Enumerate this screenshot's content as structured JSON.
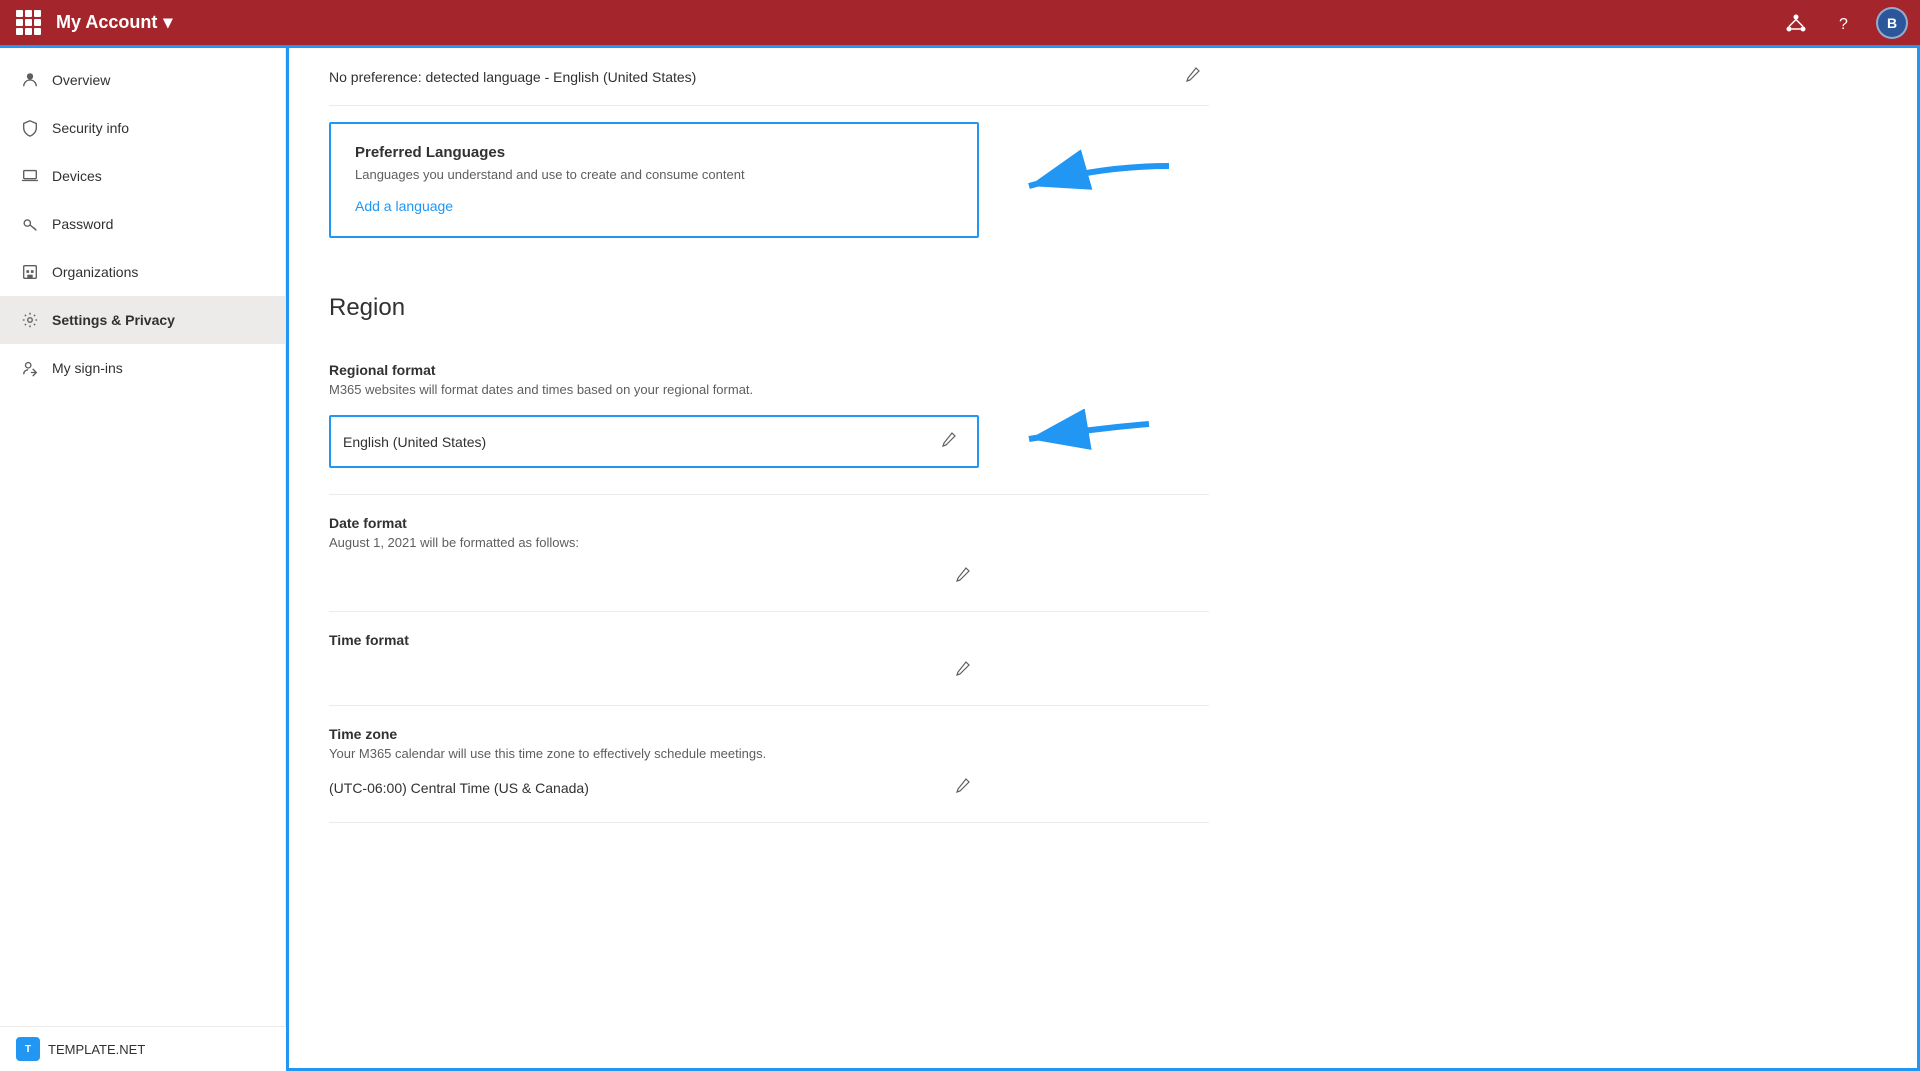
{
  "topbar": {
    "title": "My Account",
    "chevron": "▾",
    "avatar_label": "B",
    "org_icon": "⚙",
    "help_icon": "?"
  },
  "sidebar": {
    "items": [
      {
        "id": "overview",
        "label": "Overview",
        "icon": "person"
      },
      {
        "id": "security-info",
        "label": "Security info",
        "icon": "shield"
      },
      {
        "id": "devices",
        "label": "Devices",
        "icon": "laptop"
      },
      {
        "id": "password",
        "label": "Password",
        "icon": "key"
      },
      {
        "id": "organizations",
        "label": "Organizations",
        "icon": "building"
      },
      {
        "id": "settings-privacy",
        "label": "Settings & Privacy",
        "icon": "gear",
        "active": true
      },
      {
        "id": "my-sign-ins",
        "label": "My sign-ins",
        "icon": "signin"
      }
    ]
  },
  "content": {
    "no_pref_text": "No preference: detected language - English (United States)",
    "pref_lang": {
      "title": "Preferred Languages",
      "description": "Languages you understand and use to create and consume content",
      "add_link": "Add a language"
    },
    "region": {
      "section_title": "Region",
      "regional_format": {
        "label": "Regional format",
        "description": "M365 websites will format dates and times based on your regional format.",
        "value": "English (United States)"
      },
      "date_format": {
        "label": "Date format",
        "description": "August 1, 2021 will be formatted as follows:"
      },
      "time_format": {
        "label": "Time format"
      },
      "time_zone": {
        "label": "Time zone",
        "description": "Your M365 calendar will use this time zone to effectively schedule meetings.",
        "value": "(UTC-06:00) Central Time (US & Canada)"
      }
    }
  },
  "footer": {
    "logo_text": "T",
    "brand": "TEMPLATE",
    "brand_suffix": ".NET"
  }
}
